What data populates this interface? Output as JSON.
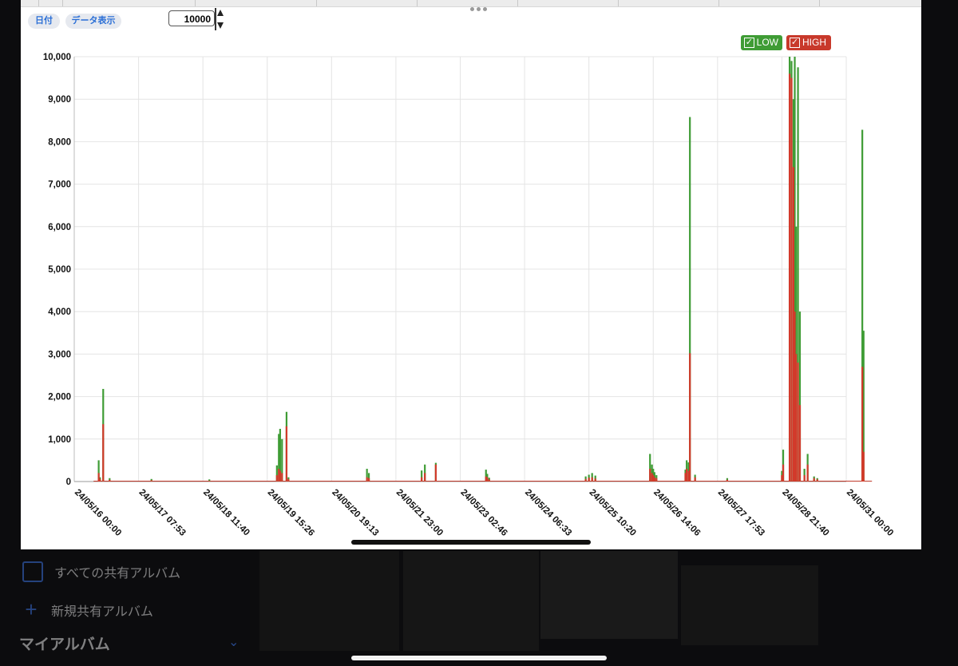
{
  "toolbar": {
    "date_button": "日付",
    "data_display_button": "データ表示",
    "max_value": "10000"
  },
  "legend": [
    {
      "label": "LOW",
      "color": "#3f9c35",
      "checked": true
    },
    {
      "label": "HIGH",
      "color": "#d23a2b",
      "checked": true
    }
  ],
  "colors": {
    "low": "#3f9c35",
    "high": "#d23a2b"
  },
  "chart_data": {
    "type": "bar",
    "title": "",
    "xlabel": "",
    "ylabel": "",
    "ylim": [
      0,
      10000
    ],
    "yticks": [
      "10,000",
      "9,000",
      "8,000",
      "7,000",
      "6,000",
      "5,000",
      "4,000",
      "3,000",
      "2,000",
      "1,000",
      "0"
    ],
    "xticks": [
      "24/05/16 00:00",
      "24/05/17 07:53",
      "24/05/18 11:40",
      "24/05/19 15:26",
      "24/05/20 19:13",
      "24/05/21 23:00",
      "24/05/23 02:46",
      "24/05/24 06:33",
      "24/05/25 10:20",
      "24/05/26 14:06",
      "24/05/27 17:53",
      "24/05/28 21:40",
      "24/05/31 00:00"
    ],
    "grid": true,
    "legend_position": "top-right",
    "series": [
      {
        "name": "LOW",
        "x": [
          0.38,
          0.4,
          0.45,
          0.55,
          1.2,
          2.1,
          3.15,
          3.18,
          3.2,
          3.23,
          3.3,
          3.33,
          4.55,
          4.58,
          5.4,
          5.45,
          5.62,
          6.4,
          6.42,
          6.45,
          7.95,
          8.0,
          8.05,
          8.1,
          8.95,
          8.98,
          9.0,
          9.02,
          9.05,
          9.5,
          9.52,
          9.55,
          9.57,
          9.65,
          10.15,
          11.0,
          11.02,
          11.12,
          11.15,
          11.18,
          11.2,
          11.22,
          11.25,
          11.28,
          11.35,
          11.4,
          11.5,
          11.55,
          12.25,
          12.27
        ],
        "values": [
          500,
          100,
          2180,
          80,
          60,
          50,
          380,
          1120,
          1240,
          1000,
          1640,
          100,
          300,
          200,
          260,
          400,
          440,
          280,
          180,
          90,
          120,
          160,
          200,
          140,
          650,
          400,
          300,
          220,
          150,
          280,
          500,
          450,
          8580,
          160,
          80,
          250,
          750,
          10000,
          9900,
          9000,
          10000,
          6000,
          9750,
          4000,
          300,
          650,
          120,
          80,
          8280,
          3550
        ]
      },
      {
        "name": "HIGH",
        "x": [
          0.38,
          0.4,
          0.45,
          0.55,
          1.2,
          2.1,
          3.15,
          3.18,
          3.2,
          3.23,
          3.3,
          3.33,
          4.55,
          4.58,
          5.4,
          5.45,
          5.62,
          6.4,
          6.42,
          6.45,
          7.95,
          8.0,
          8.05,
          8.1,
          8.95,
          8.98,
          9.0,
          9.02,
          9.05,
          9.5,
          9.52,
          9.55,
          9.57,
          9.65,
          10.15,
          11.0,
          11.02,
          11.12,
          11.15,
          11.18,
          11.2,
          11.22,
          11.25,
          11.28,
          11.35,
          11.4,
          11.5,
          11.55,
          12.25,
          12.27
        ],
        "values": [
          200,
          60,
          1350,
          40,
          30,
          20,
          150,
          300,
          250,
          200,
          1300,
          60,
          100,
          80,
          100,
          200,
          400,
          120,
          100,
          50,
          60,
          90,
          100,
          70,
          300,
          200,
          150,
          100,
          80,
          200,
          300,
          250,
          3020,
          100,
          40,
          150,
          400,
          9600,
          9500,
          7400,
          4000,
          3000,
          2800,
          1800,
          150,
          400,
          80,
          50,
          2700,
          700
        ]
      }
    ]
  },
  "background": {
    "item1": "すべての共有アルバム",
    "item2": "新規共有アルバム",
    "section": "マイアルバム"
  }
}
